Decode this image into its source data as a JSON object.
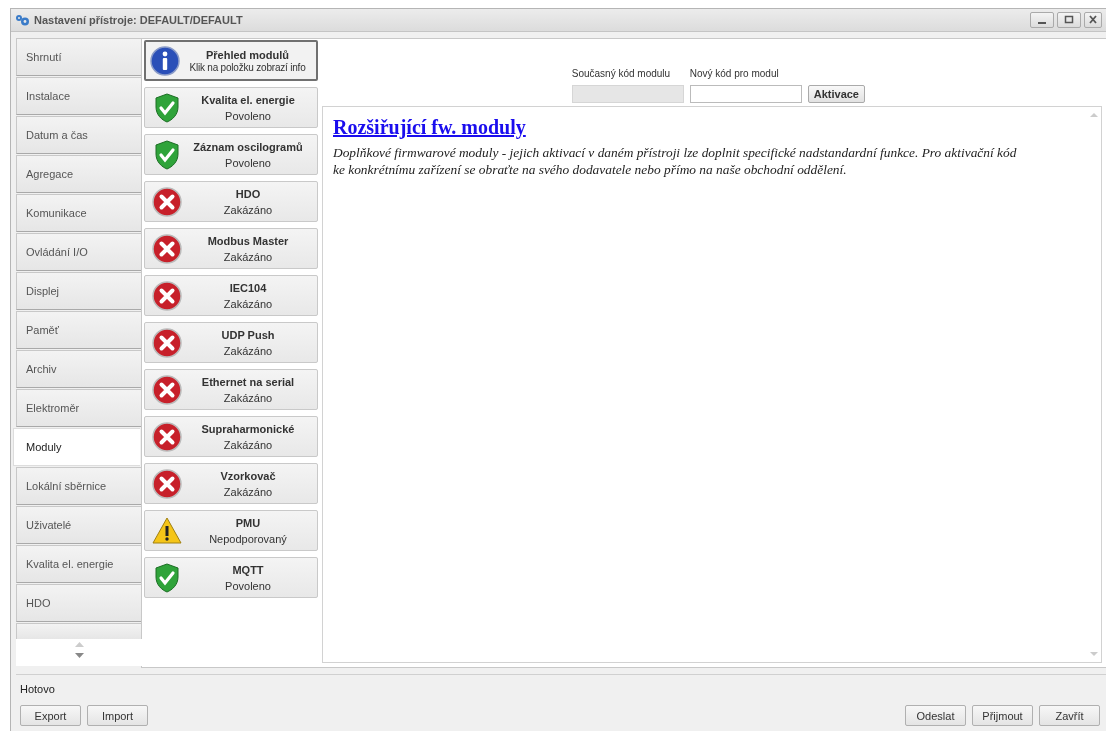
{
  "window": {
    "title": "Nastavení přístroje: DEFAULT/DEFAULT"
  },
  "nav": {
    "tabs": [
      {
        "label": "Shrnutí",
        "selected": false
      },
      {
        "label": "Instalace",
        "selected": false
      },
      {
        "label": "Datum a čas",
        "selected": false
      },
      {
        "label": "Agregace",
        "selected": false
      },
      {
        "label": "Komunikace",
        "selected": false
      },
      {
        "label": "Ovládání I/O",
        "selected": false
      },
      {
        "label": "Displej",
        "selected": false
      },
      {
        "label": "Paměť",
        "selected": false
      },
      {
        "label": "Archiv",
        "selected": false
      },
      {
        "label": "Elektroměr",
        "selected": false
      },
      {
        "label": "Moduly",
        "selected": true
      },
      {
        "label": "Lokální sběrnice",
        "selected": false
      },
      {
        "label": "Uživatelé",
        "selected": false
      },
      {
        "label": "Kvalita el. energie",
        "selected": false
      },
      {
        "label": "HDO",
        "selected": false
      }
    ]
  },
  "modules": [
    {
      "kind": "info",
      "name": "Přehled modulů",
      "status": "Klik na položku zobrazí info",
      "selected": true
    },
    {
      "kind": "enabled",
      "name": "Kvalita el. energie",
      "status": "Povoleno",
      "selected": false
    },
    {
      "kind": "enabled",
      "name": "Záznam oscilogramů",
      "status": "Povoleno",
      "selected": false
    },
    {
      "kind": "disabled",
      "name": "HDO",
      "status": "Zakázáno",
      "selected": false
    },
    {
      "kind": "disabled",
      "name": "Modbus Master",
      "status": "Zakázáno",
      "selected": false
    },
    {
      "kind": "disabled",
      "name": "IEC104",
      "status": "Zakázáno",
      "selected": false
    },
    {
      "kind": "disabled",
      "name": "UDP Push",
      "status": "Zakázáno",
      "selected": false
    },
    {
      "kind": "disabled",
      "name": "Ethernet na serial",
      "status": "Zakázáno",
      "selected": false
    },
    {
      "kind": "disabled",
      "name": "Supraharmonické",
      "status": "Zakázáno",
      "selected": false
    },
    {
      "kind": "disabled",
      "name": "Vzorkovač",
      "status": "Zakázáno",
      "selected": false
    },
    {
      "kind": "unsupported",
      "name": "PMU",
      "status": "Nepodporovaný",
      "selected": false
    },
    {
      "kind": "enabled",
      "name": "MQTT",
      "status": "Povoleno",
      "selected": false
    }
  ],
  "code_form": {
    "fields": [
      {
        "label": "Současný kód modulu",
        "disabled": true
      },
      {
        "label": "Nový kód pro modul",
        "disabled": false
      }
    ],
    "button": "Aktivace"
  },
  "info": {
    "heading": "Rozšiřující fw. moduly",
    "text": "Doplňkové firmwarové moduly - jejich aktivací v daném přístroji lze doplnit specifické nadstandardní funkce. Pro aktivační kód ke konkrétnímu zařízení se obraťte na svého dodavatele nebo přímo na naše obchodní oddělení."
  },
  "status_bar": {
    "text": "Hotovo"
  },
  "buttons_left": [
    "Export",
    "Import"
  ],
  "buttons_right": [
    "Odeslat",
    "Přijmout",
    "Zavřít"
  ]
}
